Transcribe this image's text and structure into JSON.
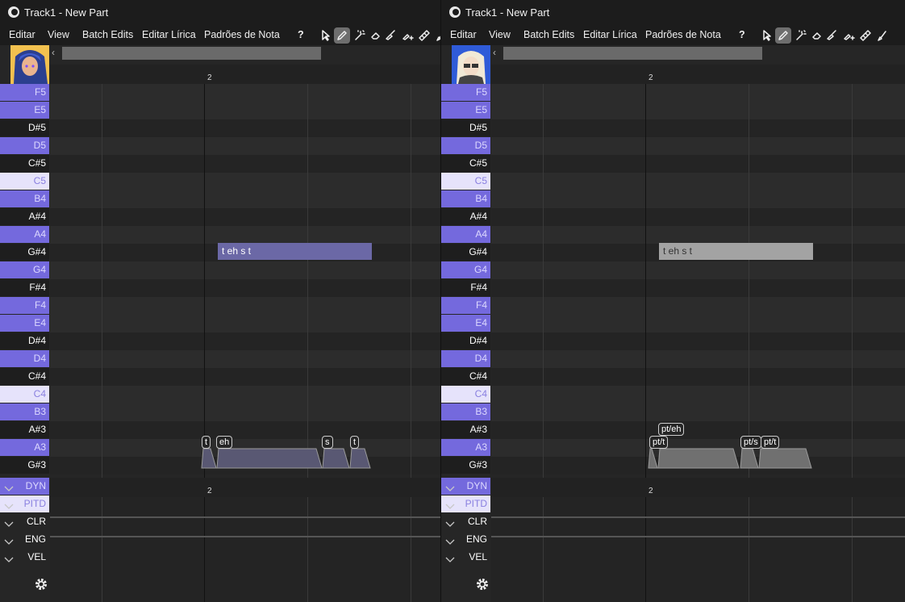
{
  "windows": [
    {
      "title": "Track1 - New Part",
      "menu": [
        "Editar",
        "View",
        "Batch Edits",
        "Editar Lírica",
        "Padrões de Nota",
        "?"
      ],
      "avatar_theme": "blue",
      "bar_marker": "2",
      "note": {
        "lyric": "t eh s t",
        "color": "#6b68a6",
        "text_color": "#ffffff"
      },
      "phonemes": [
        "t",
        "eh",
        "s",
        "t"
      ],
      "phoneme_color": "#595873"
    },
    {
      "title": "Track1 - New Part",
      "menu": [
        "Editar",
        "View",
        "Batch Edits",
        "Editar Lírica",
        "Padrões de Nota",
        "?"
      ],
      "avatar_theme": "light",
      "bar_marker": "2",
      "note": {
        "lyric": "t eh s t",
        "color": "#a3a3a3",
        "text_color": "#333333"
      },
      "phonemes": [
        "pt/t",
        "pt/eh",
        "pt/s",
        "pt/t"
      ],
      "phoneme_color": "#707070"
    }
  ],
  "piano_keys": [
    {
      "label": "F5",
      "type": "white"
    },
    {
      "label": "E5",
      "type": "white"
    },
    {
      "label": "D#5",
      "type": "black"
    },
    {
      "label": "D5",
      "type": "white"
    },
    {
      "label": "C#5",
      "type": "black"
    },
    {
      "label": "C5",
      "type": "highlight"
    },
    {
      "label": "B4",
      "type": "white"
    },
    {
      "label": "A#4",
      "type": "black"
    },
    {
      "label": "A4",
      "type": "white"
    },
    {
      "label": "G#4",
      "type": "black"
    },
    {
      "label": "G4",
      "type": "white"
    },
    {
      "label": "F#4",
      "type": "black"
    },
    {
      "label": "F4",
      "type": "white"
    },
    {
      "label": "E4",
      "type": "white"
    },
    {
      "label": "D#4",
      "type": "black"
    },
    {
      "label": "D4",
      "type": "white"
    },
    {
      "label": "C#4",
      "type": "black"
    },
    {
      "label": "C4",
      "type": "highlight"
    },
    {
      "label": "B3",
      "type": "white"
    },
    {
      "label": "A#3",
      "type": "black"
    },
    {
      "label": "A3",
      "type": "white"
    },
    {
      "label": "G#3",
      "type": "black"
    }
  ],
  "expressions": [
    {
      "label": "DYN",
      "style": "purple"
    },
    {
      "label": "PITD",
      "style": "light"
    },
    {
      "label": "CLR",
      "style": "dark"
    },
    {
      "label": "ENG",
      "style": "dark"
    },
    {
      "label": "VEL",
      "style": "dark"
    }
  ],
  "tools": [
    "select-arrow-icon",
    "pencil-icon",
    "magic-pencil-icon",
    "eraser-icon",
    "knife-icon",
    "knife-plus-icon",
    "ruler-icon",
    "brush-icon"
  ],
  "colors": {
    "accent": "#7469dd",
    "highlight_key": "#e6e3fb",
    "background": "#262626"
  }
}
